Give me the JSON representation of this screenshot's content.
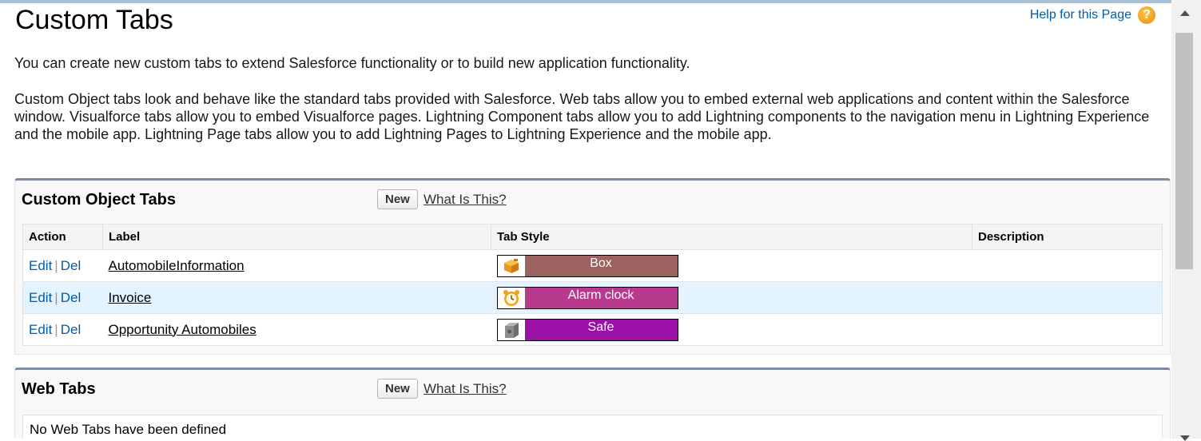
{
  "page": {
    "title": "Custom Tabs",
    "help_link": "Help for this Page",
    "intro_1": "You can create new custom tabs to extend Salesforce functionality or to build new application functionality.",
    "intro_2": "Custom Object tabs look and behave like the standard tabs provided with Salesforce. Web tabs allow you to embed external web applications and content within the Salesforce window. Visualforce tabs allow you to embed Visualforce pages. Lightning Component tabs allow you to add Lightning components to the navigation menu in Lightning Experience and the mobile app. Lightning Page tabs allow you to add Lightning Pages to Lightning Experience and the mobile app."
  },
  "custom_object_tabs": {
    "title": "Custom Object Tabs",
    "new_button": "New",
    "what_link": "What Is This?",
    "columns": {
      "action": "Action",
      "label": "Label",
      "tab_style": "Tab Style",
      "description": "Description"
    },
    "rows": [
      {
        "edit": "Edit",
        "sep": "|",
        "del": "Del",
        "label": "AutomobileInformation",
        "style": "Box",
        "style_color": "#9b6260",
        "icon": "box-icon",
        "description": ""
      },
      {
        "edit": "Edit",
        "sep": "|",
        "del": "Del",
        "label": "Invoice",
        "style": "Alarm clock",
        "style_color": "#b83a8e",
        "icon": "alarm-clock-icon",
        "description": ""
      },
      {
        "edit": "Edit",
        "sep": "|",
        "del": "Del",
        "label": "Opportunity Automobiles",
        "style": "Safe",
        "style_color": "#9b11a8",
        "icon": "safe-icon",
        "description": ""
      }
    ]
  },
  "web_tabs": {
    "title": "Web Tabs",
    "new_button": "New",
    "what_link": "What Is This?",
    "empty_message": "No Web Tabs have been defined"
  },
  "colors": {
    "link_blue": "#015ba7",
    "panel_top_border": "#7f8ba0",
    "highlight_row": "#e3f3ff"
  },
  "icons": {
    "help": "help-question-icon"
  }
}
